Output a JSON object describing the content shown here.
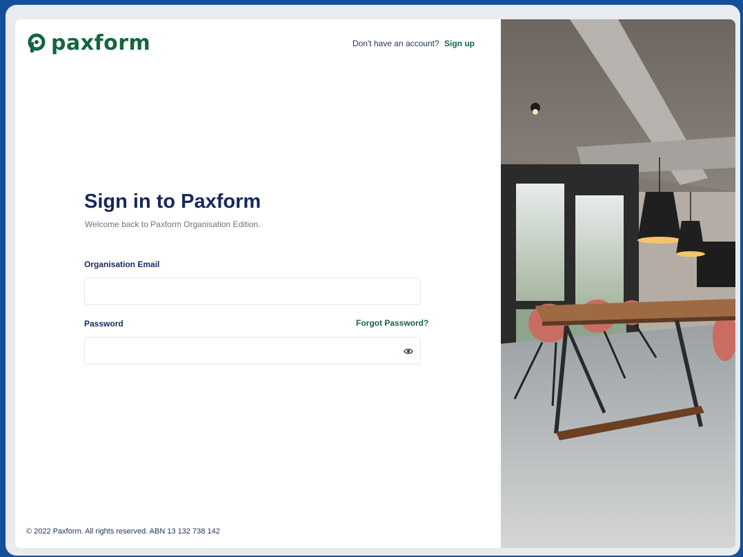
{
  "brand": {
    "name": "paxform",
    "color": "#14663d"
  },
  "header": {
    "prompt": "Don't have an account?",
    "signup_label": "Sign up"
  },
  "form": {
    "title": "Sign in to Paxform",
    "subtitle": "Welcome back to Paxform Organisation Edition.",
    "email_label": "Organisation Email",
    "email_value": "",
    "password_label": "Password",
    "password_value": "",
    "forgot_label": "Forgot Password?"
  },
  "footer": {
    "text": "© 2022 Paxform. All rights reserved. ABN 13 132 738 142"
  },
  "icons": {
    "password_toggle": "eye-icon"
  },
  "colors": {
    "primary_text": "#17275e",
    "accent": "#14663d",
    "outer_bg": "#14509a"
  }
}
